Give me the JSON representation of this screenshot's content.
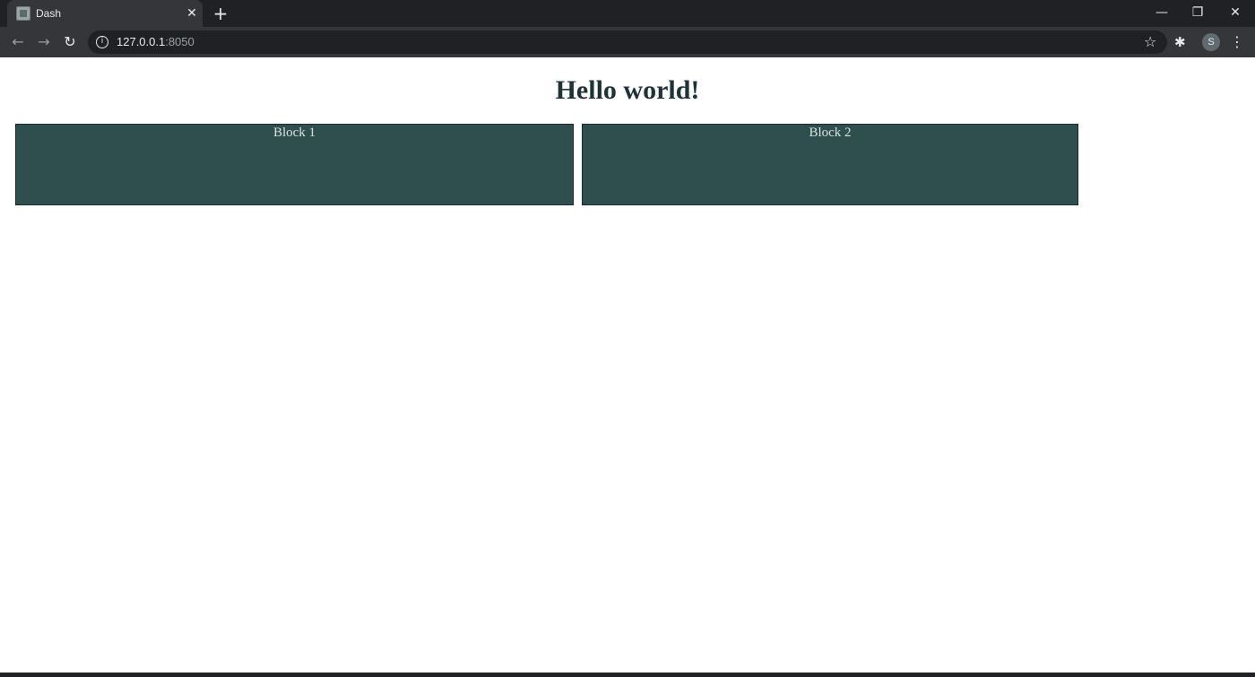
{
  "browser": {
    "tab_title": "Dash",
    "tab_close": "✕",
    "new_tab": "+",
    "url_host": "127.0.0.1",
    "url_port": ":8050",
    "profile_initial": "S",
    "icons": {
      "favicon": "dash-favicon-icon",
      "back": "arrow-left-icon",
      "forward": "arrow-right-icon",
      "reload": "reload-icon",
      "info": "info-icon",
      "bookmark": "star-icon",
      "extensions": "puzzle-icon",
      "menu": "kebab-menu-icon",
      "minimize": "minimize-icon",
      "maximize": "restore-icon",
      "close": "close-icon"
    }
  },
  "page": {
    "heading": "Hello world!",
    "blocks": [
      {
        "label": "Block 1"
      },
      {
        "label": "Block 2"
      }
    ]
  },
  "colors": {
    "heading": "#1f3236",
    "block_background": "#2f4f4f",
    "block_text": "#d9e0e0",
    "chrome_dark": "#202124",
    "chrome_mid": "#35363a"
  }
}
